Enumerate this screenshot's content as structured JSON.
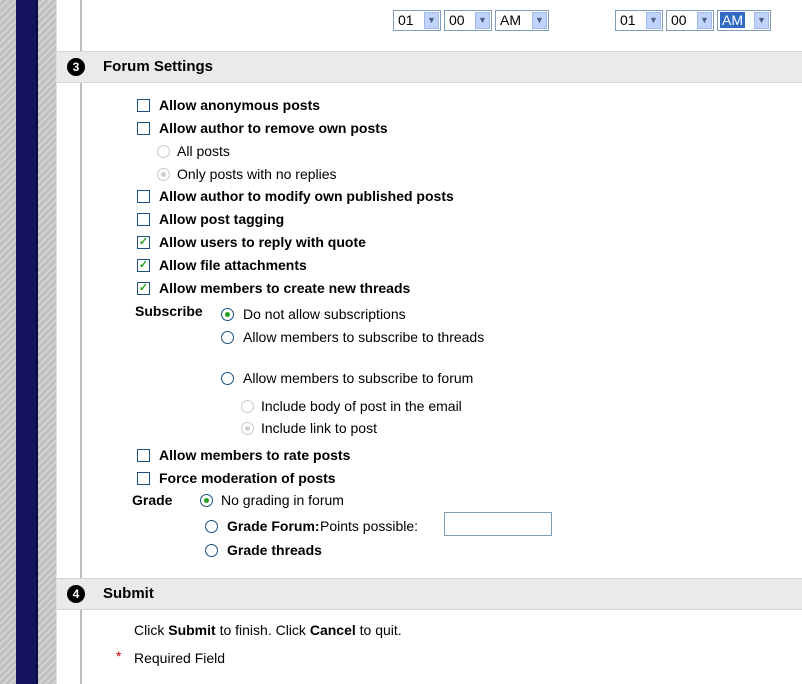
{
  "time_selects": {
    "start": {
      "hour": "01",
      "minute": "00",
      "ampm": "AM"
    },
    "end": {
      "hour": "01",
      "minute": "00",
      "ampm": "AM"
    }
  },
  "forum_settings": {
    "step": "❸",
    "title": "Forum Settings",
    "allow_anonymous": {
      "label": "Allow anonymous posts",
      "checked": false
    },
    "allow_remove": {
      "label": "Allow author to remove own posts",
      "checked": false
    },
    "remove_all": {
      "label": "All posts",
      "selected": false
    },
    "remove_no_replies": {
      "label": "Only posts with no replies",
      "selected": true
    },
    "allow_modify": {
      "label": "Allow author to modify own published posts",
      "checked": false
    },
    "allow_tagging": {
      "label": "Allow post tagging",
      "checked": false
    },
    "allow_quote": {
      "label": "Allow users to reply with quote",
      "checked": true
    },
    "allow_attachments": {
      "label": "Allow file attachments",
      "checked": true
    },
    "allow_new_threads": {
      "label": "Allow members to create new threads",
      "checked": true
    },
    "subscribe": {
      "label": "Subscribe",
      "none": {
        "label": "Do not allow subscriptions",
        "selected": true
      },
      "threads": {
        "label": "Allow members to subscribe to threads",
        "selected": false
      },
      "forum": {
        "label": "Allow members to subscribe to forum",
        "selected": false
      },
      "include_body": {
        "label": "Include body of post in the email",
        "selected": false
      },
      "include_link": {
        "label": "Include link to post",
        "selected": true
      }
    },
    "allow_rate": {
      "label": "Allow members to rate posts",
      "checked": false
    },
    "force_moderation": {
      "label": "Force moderation of posts",
      "checked": false
    },
    "grade": {
      "label": "Grade",
      "none": {
        "label": "No grading in forum",
        "selected": true
      },
      "forum_label": "Grade Forum:",
      "points_label": "Points possible:",
      "points_value": "",
      "threads_label": "Grade threads"
    }
  },
  "submit_section": {
    "step": "❹",
    "title": "Submit",
    "instr_1": "Click ",
    "instr_submit": "Submit",
    "instr_2": " to finish. Click ",
    "instr_cancel": "Cancel",
    "instr_3": " to quit.",
    "required_star": "*",
    "required_label": "Required Field"
  }
}
